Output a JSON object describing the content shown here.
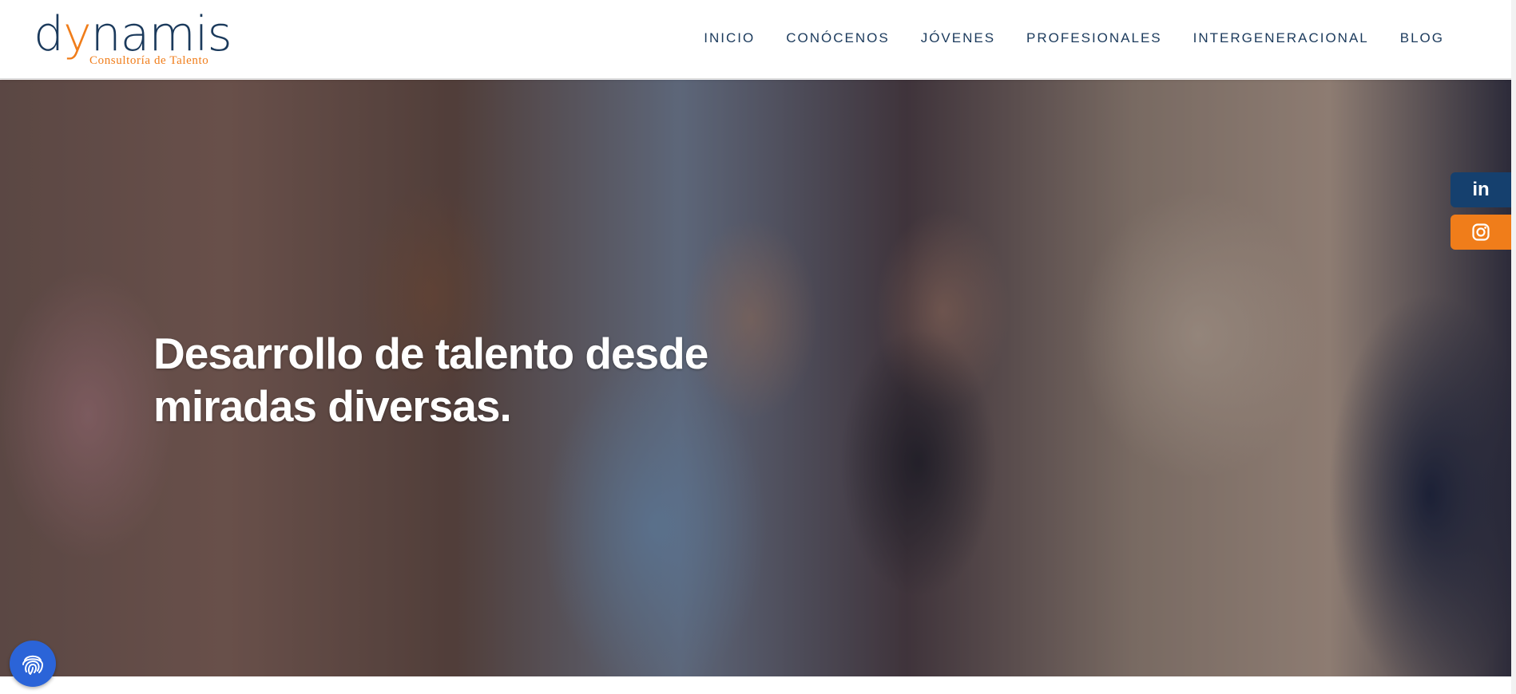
{
  "brand": {
    "name_part1": "d",
    "name_accent": "y",
    "name_part2": "nam",
    "name_i": "i",
    "name_part3": "s",
    "tagline": "Consultoría de Talento",
    "color_primary": "#1b3a5c",
    "color_accent": "#f07d1a"
  },
  "nav": {
    "items": [
      {
        "label": "INICIO"
      },
      {
        "label": "CONÓCENOS"
      },
      {
        "label": "JÓVENES"
      },
      {
        "label": "PROFESIONALES"
      },
      {
        "label": "INTERGENERACIONAL"
      },
      {
        "label": "BLOG"
      }
    ]
  },
  "hero": {
    "title": "Desarrollo de talento desde miradas diversas."
  },
  "social": {
    "linkedin_label": "in",
    "linkedin_icon": "linkedin-icon",
    "instagram_icon": "instagram-icon",
    "linkedin_color": "#15406e",
    "instagram_color": "#f07d1a"
  },
  "accessibility": {
    "icon": "fingerprint-icon",
    "color": "#2b64d8"
  }
}
